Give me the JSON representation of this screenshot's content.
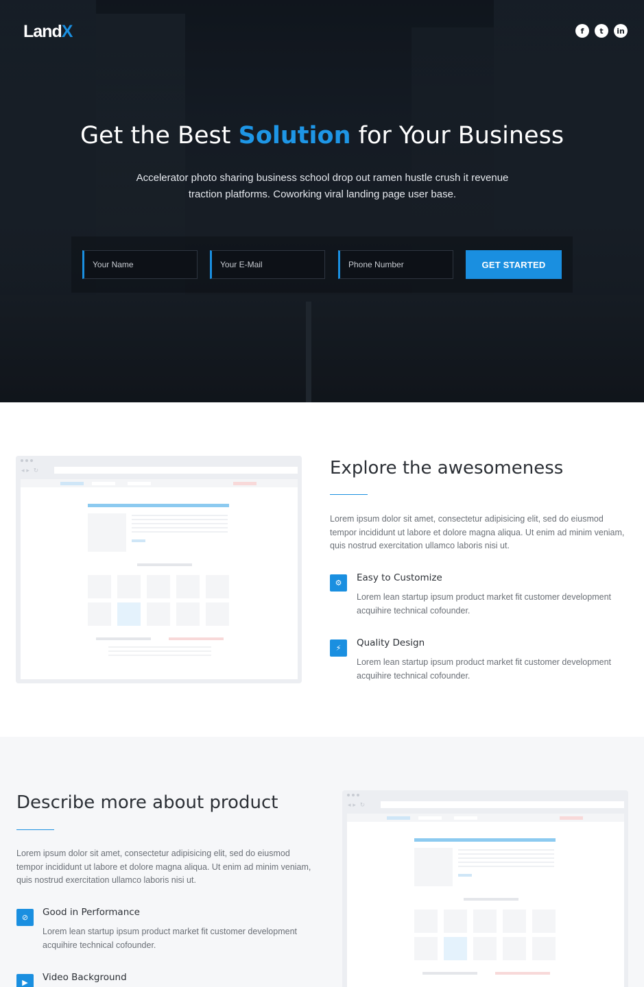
{
  "header": {
    "logo_main": "Land",
    "logo_accent": "X",
    "social": [
      {
        "icon": "facebook-icon",
        "glyph": "f"
      },
      {
        "icon": "twitter-icon",
        "glyph": "t"
      },
      {
        "icon": "linkedin-icon",
        "glyph": "in"
      }
    ]
  },
  "hero": {
    "title_before": "Get the Best ",
    "title_accent": "Solution",
    "title_after": " for Your Business",
    "subtitle": "Accelerator photo sharing business school drop out ramen hustle crush it revenue traction platforms. Coworking viral landing page user base.",
    "form": {
      "name_placeholder": "Your Name",
      "email_placeholder": "Your E-Mail",
      "phone_placeholder": "Phone Number",
      "submit_label": "GET STARTED"
    }
  },
  "explore": {
    "title": "Explore the awesomeness",
    "text": "Lorem ipsum dolor sit amet, consectetur adipisicing elit, sed do eiusmod tempor incididunt ut labore et dolore magna aliqua. Ut enim ad minim veniam, quis nostrud exercitation ullamco laboris nisi ut.",
    "features": [
      {
        "icon": "gear-icon",
        "glyph": "⚙",
        "title": "Easy to Customize",
        "desc": "Lorem lean startup ipsum product market fit customer development acquihire technical cofounder."
      },
      {
        "icon": "lightning-icon",
        "glyph": "⚡",
        "title": "Quality Design",
        "desc": "Lorem lean startup ipsum product market fit customer development acquihire technical cofounder."
      }
    ]
  },
  "describe": {
    "title": "Describe more about product",
    "text": "Lorem ipsum dolor sit amet, consectetur adipisicing elit, sed do eiusmod tempor incididunt ut labore et dolore magna aliqua. Ut enim ad minim veniam, quis nostrud exercitation ullamco laboris nisi ut.",
    "features": [
      {
        "icon": "speedometer-icon",
        "glyph": "⊘",
        "title": "Good in Performance",
        "desc": "Lorem lean startup ipsum product market fit customer development acquihire technical cofounder."
      },
      {
        "icon": "video-icon",
        "glyph": "▶",
        "title": "Video Background",
        "desc": ""
      }
    ]
  },
  "colors": {
    "accent": "#1a8fe0",
    "hero_bg": "#1b222c",
    "section_alt_bg": "#f6f7f9"
  }
}
